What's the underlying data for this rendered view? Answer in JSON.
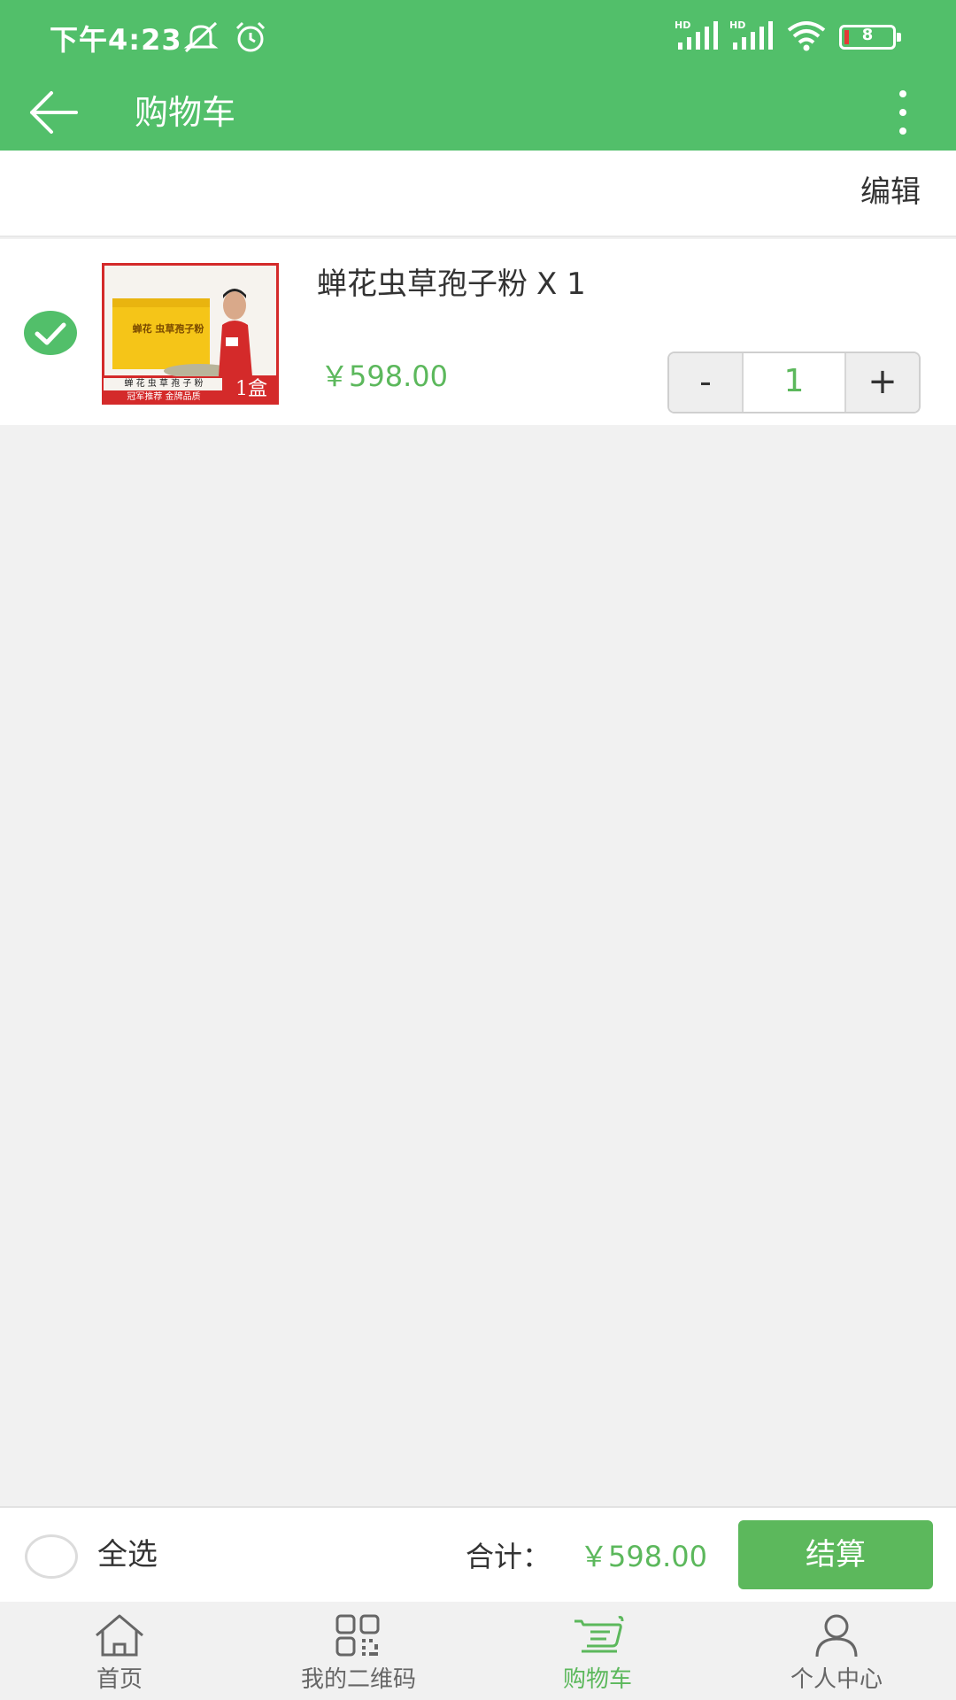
{
  "status_bar": {
    "time": "下午4:23",
    "battery": "8"
  },
  "app_bar": {
    "title": "购物车"
  },
  "edit_bar": {
    "edit_label": "编辑"
  },
  "cart_items": [
    {
      "name": "蝉花虫草孢子粉",
      "qty_suffix": "X 1",
      "price": "￥598.00",
      "quantity": "1",
      "checked": true,
      "image_text": {
        "box_label": "蝉花 虫草孢子粉",
        "banner": "蝉 花 虫 草 孢 子 粉",
        "sub_banner": "冠军推荐  金牌品质",
        "badge": "1盒"
      }
    }
  ],
  "stepper": {
    "minus": "-",
    "plus": "+"
  },
  "footer": {
    "select_all_label": "全选",
    "total_label": "合计：",
    "total_value": "￥598.00",
    "checkout_label": "结算"
  },
  "tabs": [
    {
      "label": "首页",
      "icon": "home-icon"
    },
    {
      "label": "我的二维码",
      "icon": "qr-code-icon"
    },
    {
      "label": "购物车",
      "icon": "cart-icon",
      "active": true
    },
    {
      "label": "个人中心",
      "icon": "user-icon"
    }
  ],
  "colors": {
    "primary": "#52bf6a",
    "accent": "#5cb85c",
    "background": "#f1f1f1"
  }
}
